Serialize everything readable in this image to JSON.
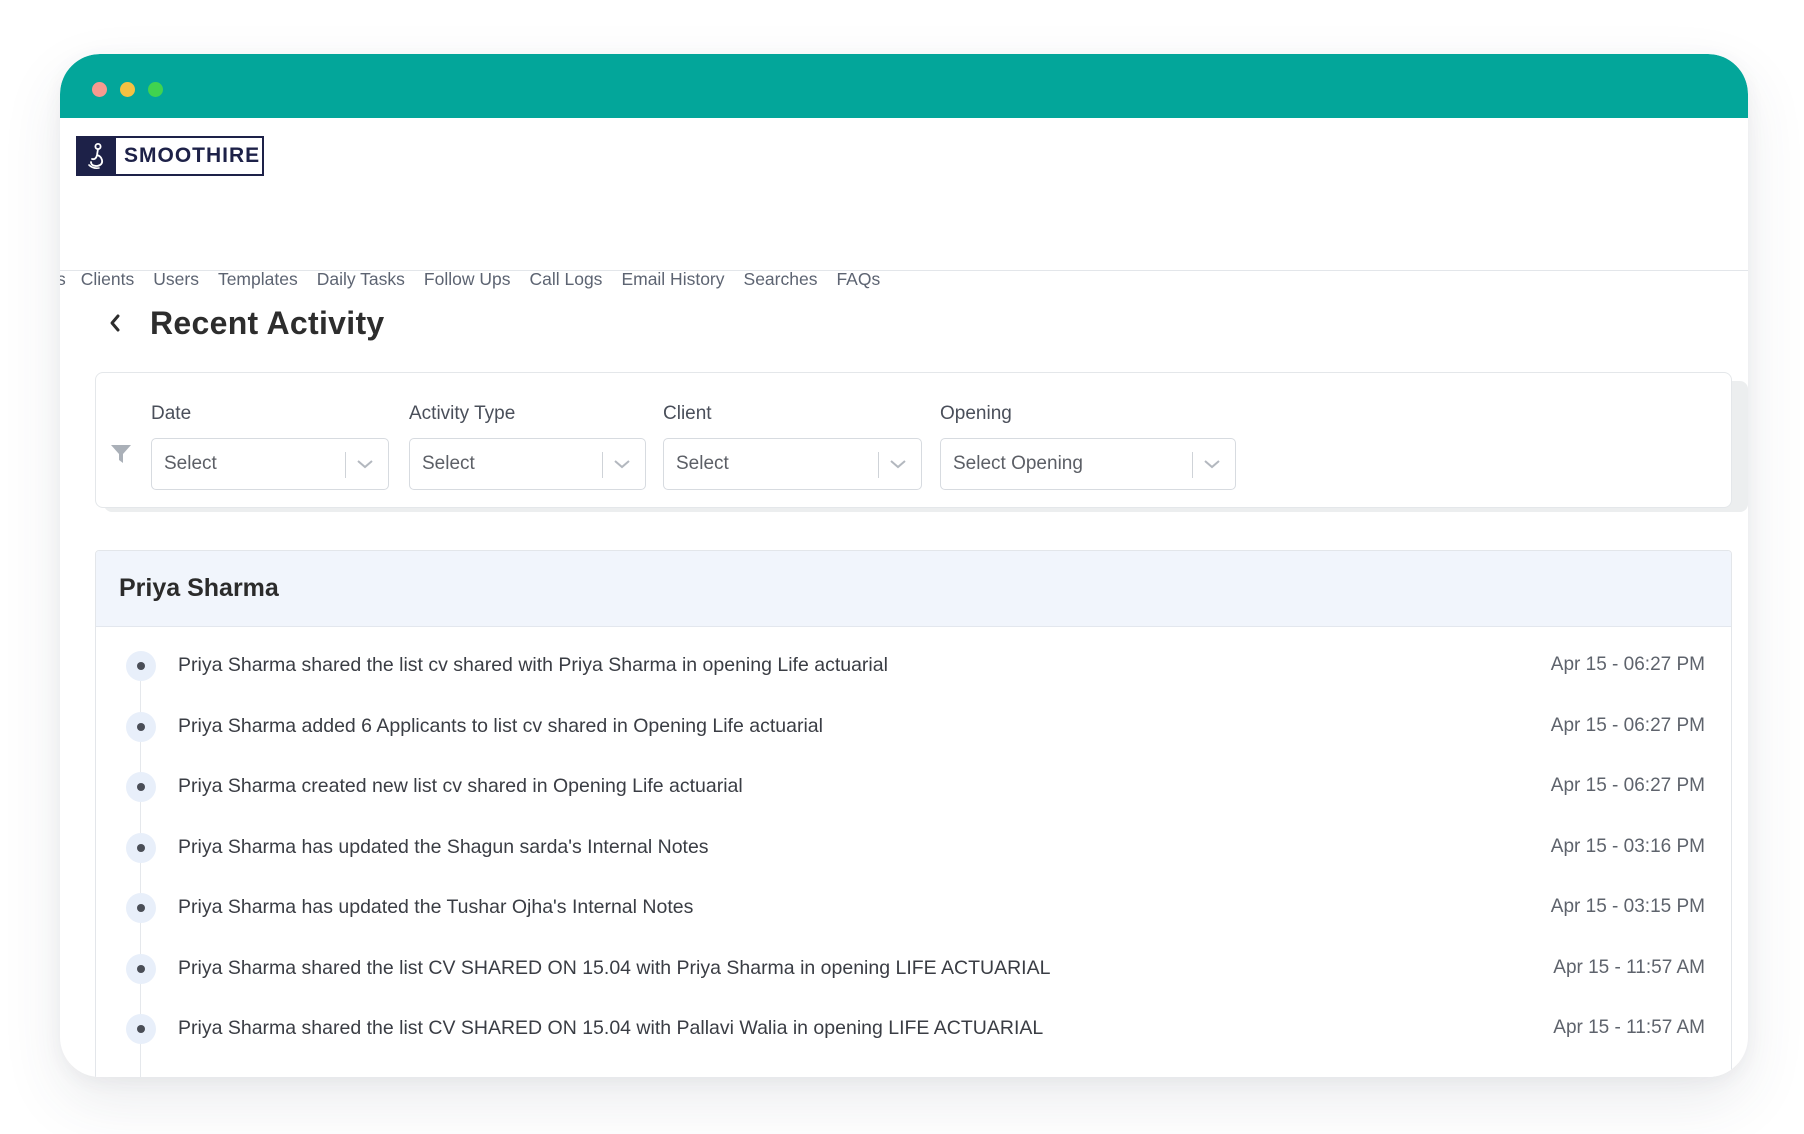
{
  "brand": {
    "name": "SMOOTHIRE",
    "colors": {
      "titlebar": "#03a69a",
      "logo": "#1d2148"
    }
  },
  "window_controls": [
    "close",
    "minimize",
    "maximize"
  ],
  "nav": {
    "cut_item": "s",
    "items": [
      "Clients",
      "Users",
      "Templates",
      "Daily Tasks",
      "Follow Ups",
      "Call Logs",
      "Email History",
      "Searches",
      "FAQs"
    ]
  },
  "page": {
    "title": "Recent Activity"
  },
  "filters": {
    "date": {
      "label": "Date",
      "value": "Select"
    },
    "activity_type": {
      "label": "Activity Type",
      "value": "Select"
    },
    "client": {
      "label": "Client",
      "value": "Select"
    },
    "opening": {
      "label": "Opening",
      "value": "Select Opening"
    }
  },
  "activity": {
    "user": "Priya Sharma",
    "items": [
      {
        "text": "Priya Sharma shared the list cv shared with Priya Sharma in opening Life actuarial",
        "time": "Apr 15 - 06:27 PM"
      },
      {
        "text": "Priya Sharma added 6 Applicants to list cv shared in Opening Life actuarial",
        "time": "Apr 15 - 06:27 PM"
      },
      {
        "text": "Priya Sharma created new list cv shared in Opening Life actuarial",
        "time": "Apr 15 - 06:27 PM"
      },
      {
        "text": "Priya Sharma has updated the Shagun sarda's Internal Notes",
        "time": "Apr 15 - 03:16 PM"
      },
      {
        "text": "Priya Sharma has updated the Tushar Ojha's Internal Notes",
        "time": "Apr 15 - 03:15 PM"
      },
      {
        "text": "Priya Sharma shared the list CV SHARED ON 15.04 with Priya Sharma in opening LIFE ACTUARIAL",
        "time": "Apr 15 - 11:57 AM"
      },
      {
        "text": "Priya Sharma shared the list CV SHARED ON 15.04 with Pallavi Walia in opening LIFE ACTUARIAL",
        "time": "Apr 15 - 11:57 AM"
      }
    ]
  }
}
